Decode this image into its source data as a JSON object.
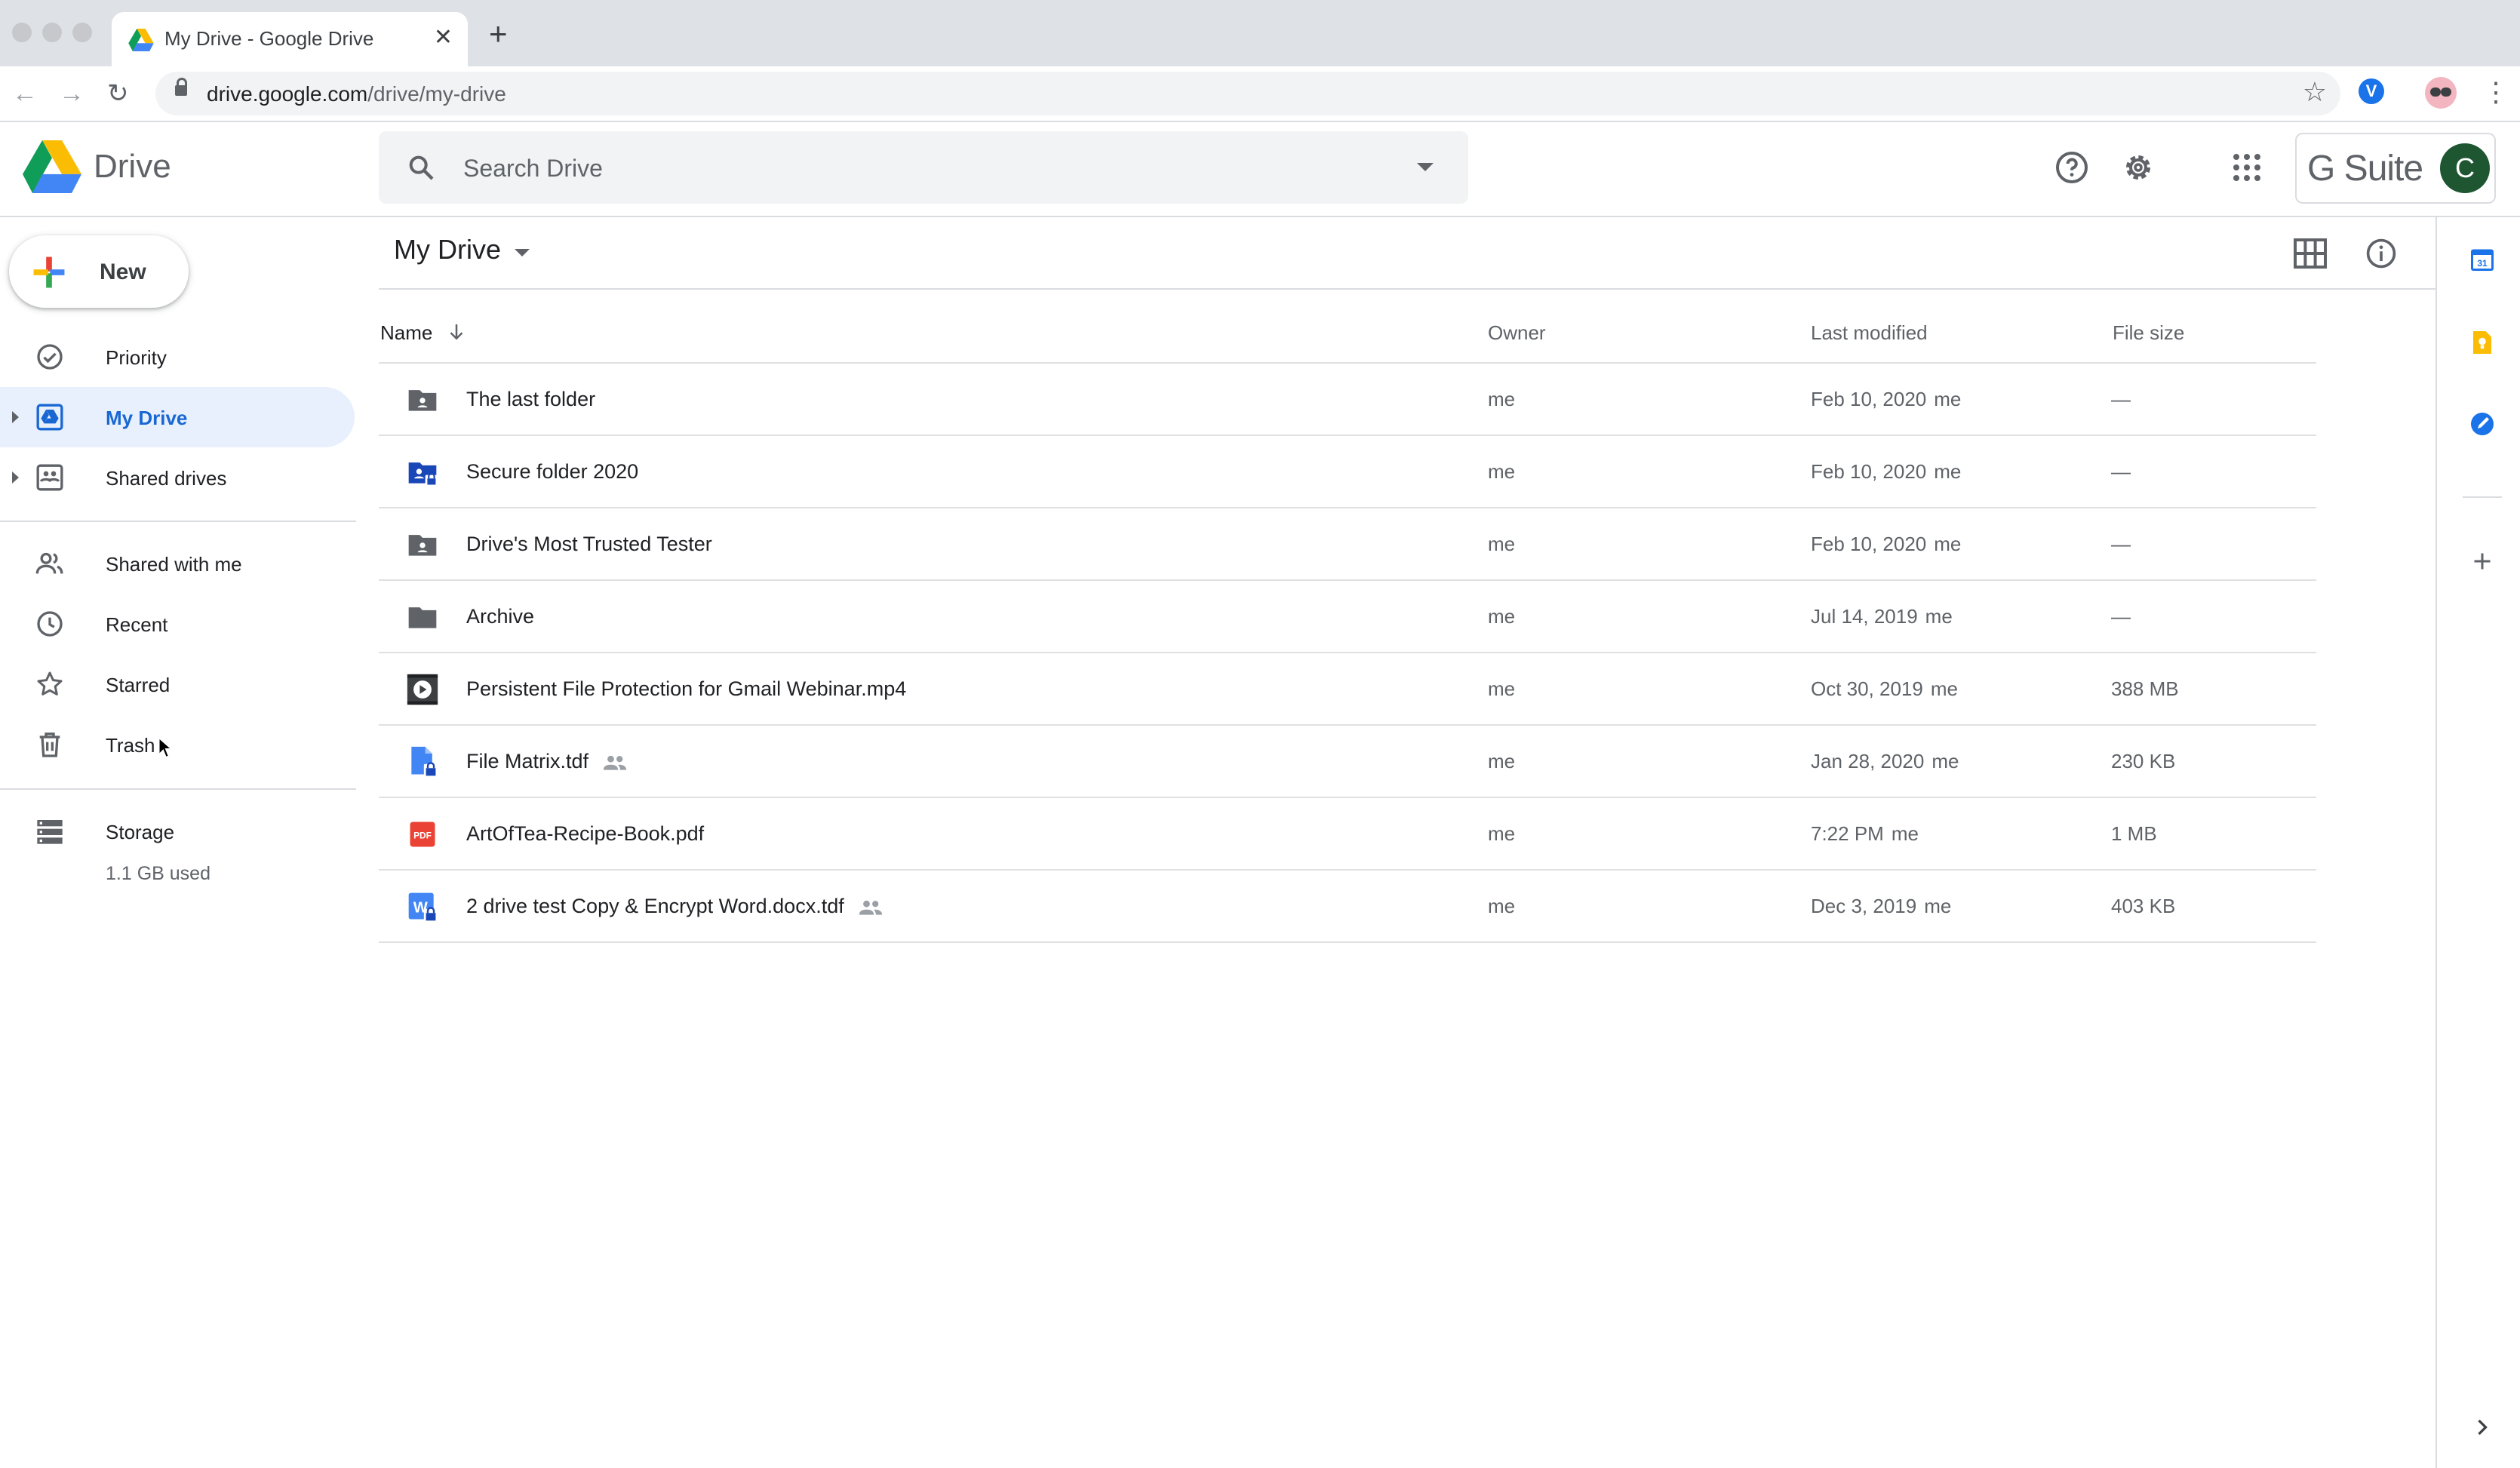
{
  "browser": {
    "tab_title": "My Drive - Google Drive",
    "url_host": "drive.google.com",
    "url_path": "/drive/my-drive"
  },
  "header": {
    "app_name": "Drive",
    "search_placeholder": "Search Drive",
    "gsuite_label": "G Suite",
    "avatar_initial": "C"
  },
  "sidebar": {
    "new_label": "New",
    "items": [
      {
        "label": "Priority",
        "icon": "priority-icon"
      },
      {
        "label": "My Drive",
        "icon": "my-drive-icon",
        "active": true
      },
      {
        "label": "Shared drives",
        "icon": "shared-drives-icon"
      },
      {
        "label": "Shared with me",
        "icon": "shared-with-me-icon"
      },
      {
        "label": "Recent",
        "icon": "clock-icon"
      },
      {
        "label": "Starred",
        "icon": "star-icon"
      },
      {
        "label": "Trash",
        "icon": "trash-icon"
      }
    ],
    "storage": {
      "label": "Storage",
      "used": "1.1 GB used"
    }
  },
  "main": {
    "title": "My Drive",
    "columns": {
      "name": "Name",
      "owner": "Owner",
      "last_modified": "Last modified",
      "file_size": "File size"
    },
    "rows": [
      {
        "name": "The last folder",
        "icon": "shared-folder-icon",
        "owner": "me",
        "modified": "Feb 10, 2020",
        "modified_by": "me",
        "size": "—",
        "shared": false
      },
      {
        "name": "Secure folder 2020",
        "icon": "secure-folder-icon",
        "owner": "me",
        "modified": "Feb 10, 2020",
        "modified_by": "me",
        "size": "—",
        "shared": false
      },
      {
        "name": "Drive's Most Trusted Tester",
        "icon": "shared-folder-icon",
        "owner": "me",
        "modified": "Feb 10, 2020",
        "modified_by": "me",
        "size": "—",
        "shared": false
      },
      {
        "name": "Archive",
        "icon": "folder-icon",
        "owner": "me",
        "modified": "Jul 14, 2019",
        "modified_by": "me",
        "size": "—",
        "shared": false
      },
      {
        "name": "Persistent File Protection for Gmail Webinar.mp4",
        "icon": "video-icon",
        "owner": "me",
        "modified": "Oct 30, 2019",
        "modified_by": "me",
        "size": "388 MB",
        "shared": false
      },
      {
        "name": "File Matrix.tdf",
        "icon": "secure-file-icon",
        "owner": "me",
        "modified": "Jan 28, 2020",
        "modified_by": "me",
        "size": "230 KB",
        "shared": true
      },
      {
        "name": "ArtOfTea-Recipe-Book.pdf",
        "icon": "pdf-icon",
        "owner": "me",
        "modified": "7:22 PM",
        "modified_by": "me",
        "size": "1 MB",
        "shared": false
      },
      {
        "name": "2 drive test Copy & Encrypt Word.docx.tdf",
        "icon": "secure-word-icon",
        "owner": "me",
        "modified": "Dec 3, 2019",
        "modified_by": "me",
        "size": "403 KB",
        "shared": true
      }
    ]
  },
  "side_panel": {
    "calendar_day": "31",
    "colors": {
      "calendar": "#1a73e8",
      "keep": "#fbbc04",
      "tasks": "#1a73e8"
    }
  },
  "colors": {
    "accent": "#1967d2",
    "active_bg": "#e8f0fe",
    "pdf_red": "#ea4335",
    "secure_blue": "#1a47b8"
  }
}
